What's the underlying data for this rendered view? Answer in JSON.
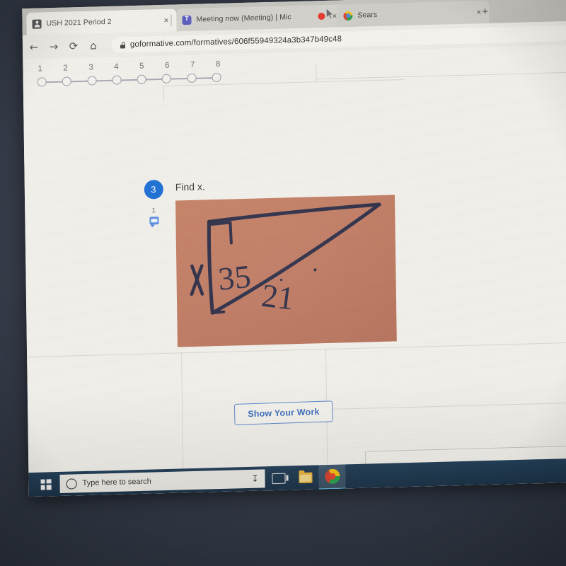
{
  "browser": {
    "tabs": [
      {
        "title": "USH 2021 Period 2",
        "favicon": "person-icon",
        "active": true,
        "close_label": "×"
      },
      {
        "title": "Meeting now (Meeting) | Mic",
        "favicon": "teams-icon",
        "active": false,
        "recording": true,
        "close_label": "×"
      },
      {
        "title": "Sears",
        "favicon": "chrome-icon",
        "active": false,
        "close_label": "×"
      }
    ],
    "new_tab_label": "+",
    "nav": {
      "back": "←",
      "forward": "→",
      "reload": "⟳",
      "home": "⌂"
    },
    "address_bar": {
      "url": "goformative.com/formatives/606f55949324a3b347b49c48",
      "secure_icon": "lock-icon"
    }
  },
  "formative": {
    "question_nav": {
      "numbers": [
        "1",
        "2",
        "3",
        "4",
        "5",
        "6",
        "7",
        "8"
      ]
    },
    "question": {
      "number": "3",
      "prompt": "Find x.",
      "points": "1",
      "comment_icon": "comment-icon",
      "figure": {
        "background_color": "#c07b63",
        "labels": [
          "X",
          "35",
          "21"
        ],
        "description_marks": [
          "right-angle-square"
        ]
      }
    },
    "show_work_button": "Show Your Work",
    "answer_field_placeholder": ""
  },
  "taskbar": {
    "start_label": "start-button",
    "search_placeholder": "Type here to search",
    "mic_icon": "microphone-icon",
    "items": [
      {
        "name": "task-view-icon"
      },
      {
        "name": "file-explorer-icon"
      },
      {
        "name": "chrome-icon",
        "active": true
      }
    ]
  },
  "colors": {
    "accent_blue": "#1c6fd4",
    "button_blue": "#3d6fbd",
    "figure_brown": "#c07b63",
    "taskbar_navy": "#1d3448",
    "record_red": "#e23b30"
  }
}
